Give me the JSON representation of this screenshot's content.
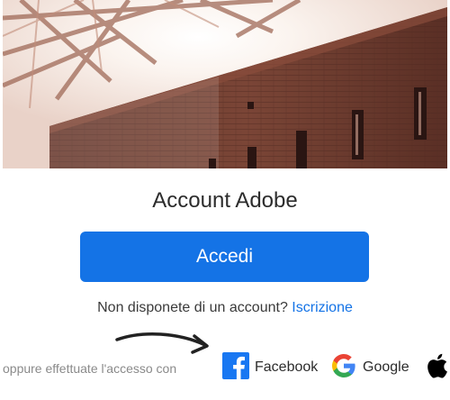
{
  "header": {
    "title": "Account Adobe"
  },
  "actions": {
    "sign_in_label": "Accedi",
    "no_account_text": "Non disponete di un account?",
    "signup_link": "Iscrizione"
  },
  "social": {
    "intro_text": "oppure effettuate l'accesso con",
    "providers": [
      {
        "name": "Facebook",
        "icon": "facebook-icon",
        "color": "#1877f2"
      },
      {
        "name": "Google",
        "icon": "google-icon",
        "color": "#4285f4"
      },
      {
        "name": "",
        "icon": "apple-icon",
        "color": "#000000"
      }
    ]
  },
  "colors": {
    "accent": "#1473e6",
    "text": "#2c2c2c"
  }
}
